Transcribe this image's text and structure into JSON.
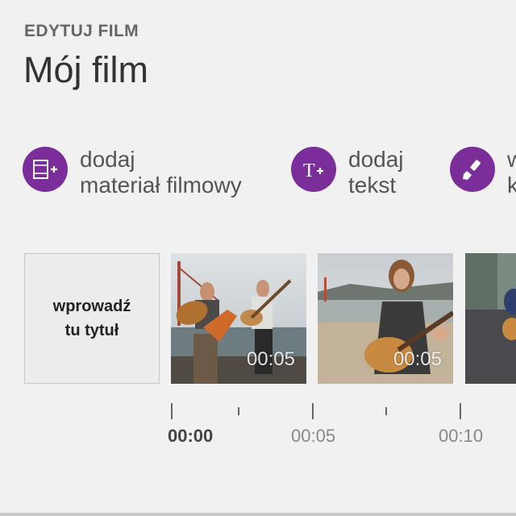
{
  "header": {
    "overline": "EDYTUJ FILM",
    "title": "Mój film"
  },
  "actions": [
    {
      "icon": "film-add-icon",
      "line1": "dodaj",
      "line2": "materiał filmowy"
    },
    {
      "icon": "text-add-icon",
      "line1": "dodaj",
      "line2": "tekst"
    },
    {
      "icon": "brush-icon",
      "line1": "w",
      "line2": "k"
    }
  ],
  "timeline": {
    "title_card": {
      "line1": "wprowadź",
      "line2": "tu tytuł"
    },
    "clips": [
      {
        "duration": "00:05"
      },
      {
        "duration": "00:05"
      },
      {
        "duration": ""
      }
    ],
    "ruler": [
      "00:00",
      "00:05",
      "00:10"
    ]
  },
  "colors": {
    "accent": "#7b2e9a",
    "background": "#f0f1f0"
  }
}
